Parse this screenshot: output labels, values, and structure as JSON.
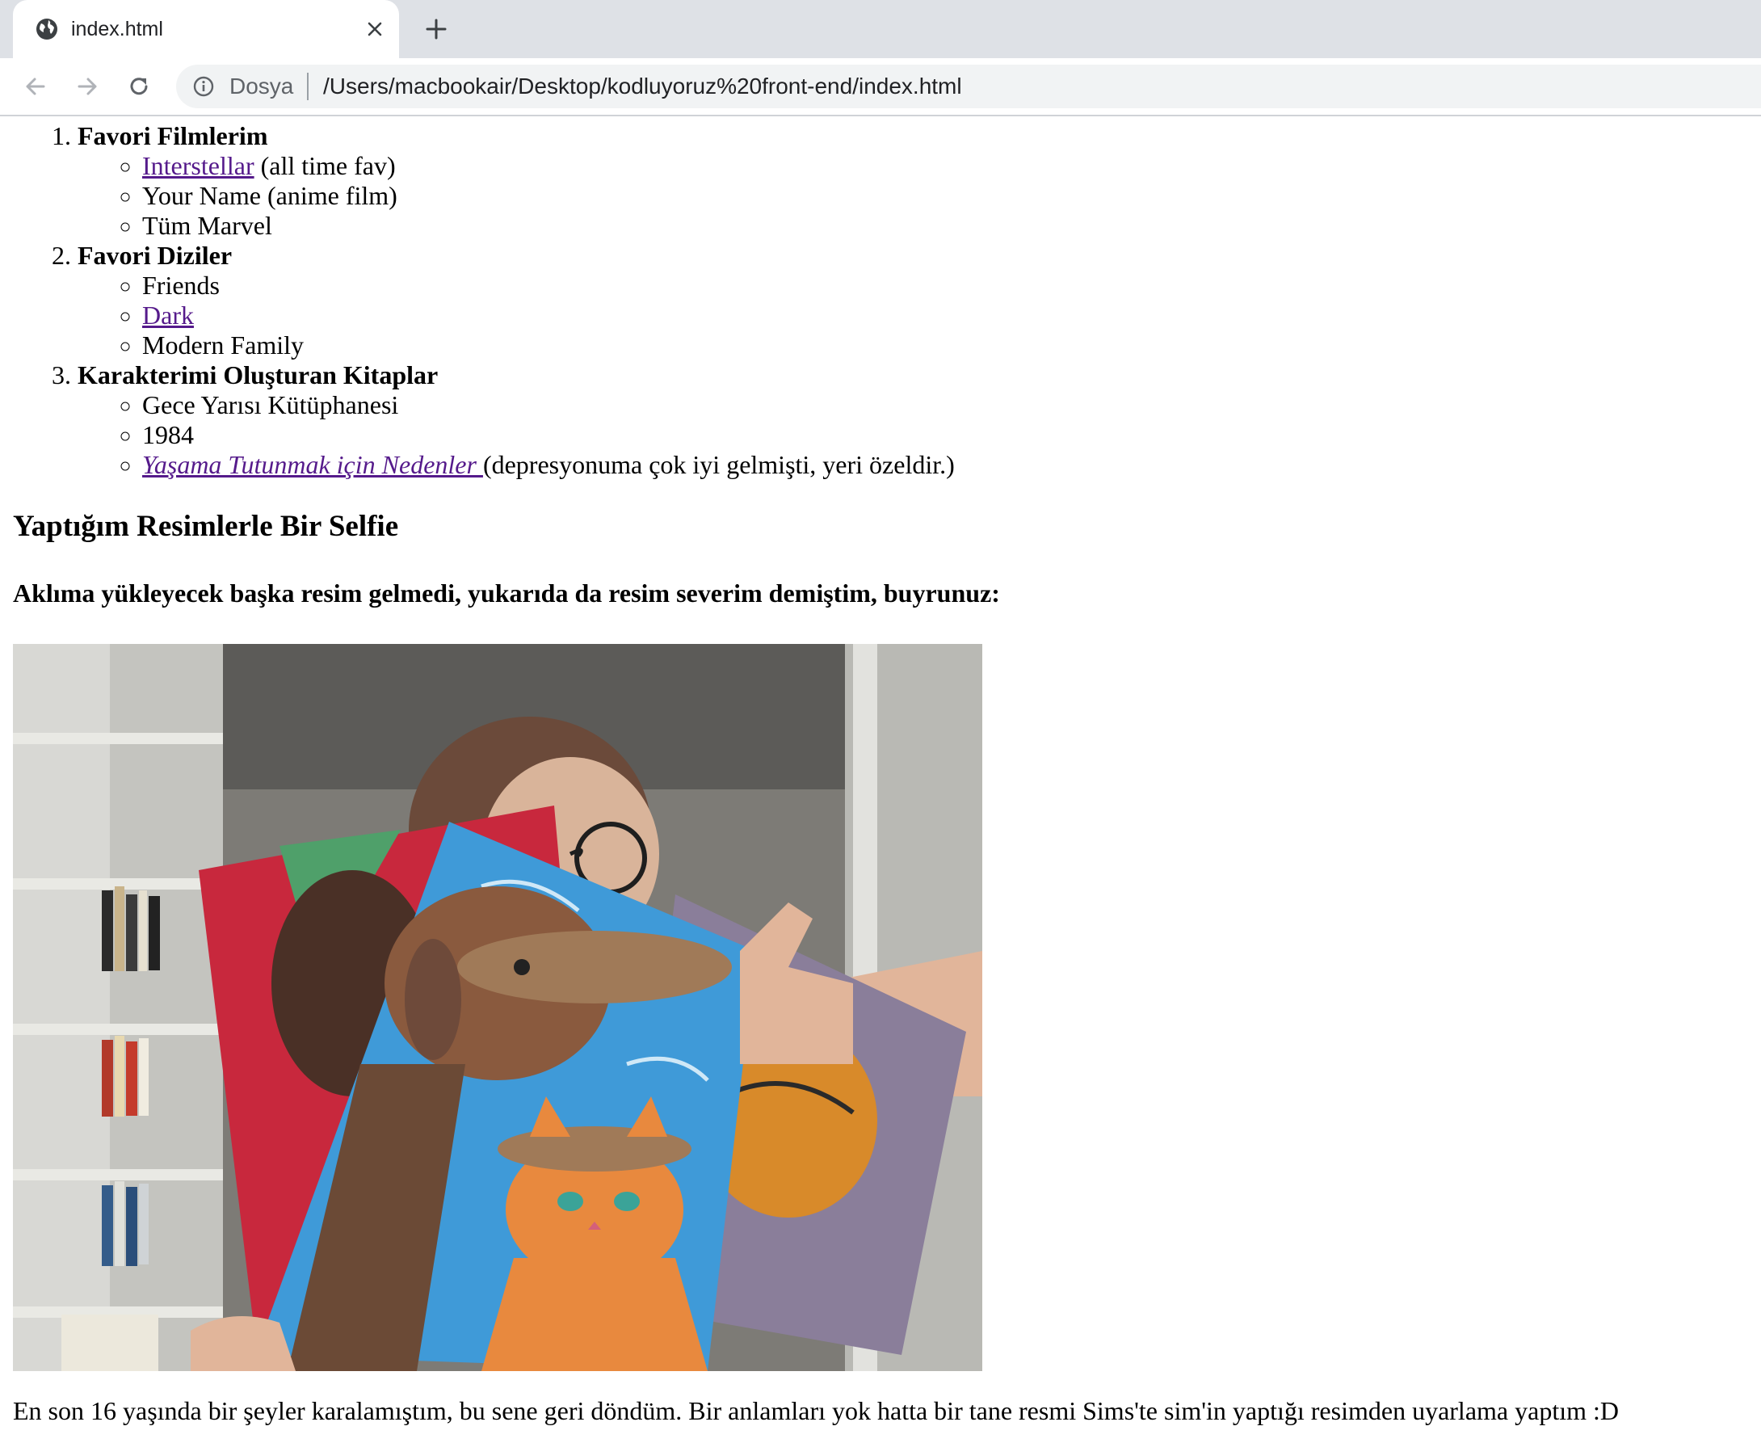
{
  "browser": {
    "tab": {
      "title": "index.html",
      "favicon": "globe-icon",
      "close": "close-icon"
    },
    "new_tab": "plus-icon",
    "nav": {
      "back": "arrow-left-icon",
      "forward": "arrow-right-icon",
      "reload": "reload-icon"
    },
    "omnibox": {
      "scheme_label": "Dosya",
      "url": "/Users/macbookair/Desktop/kodluyoruz%20front-end/index.html",
      "info": "info-icon"
    }
  },
  "page": {
    "lists": [
      {
        "number": "1.",
        "title": "Favori Filmlerim",
        "items": [
          {
            "link": "Interstellar",
            "text": " (all time fav)"
          },
          {
            "text": "Your Name (anime film)"
          },
          {
            "text": "Tüm Marvel"
          }
        ]
      },
      {
        "number": "2.",
        "title": "Favori Diziler",
        "items": [
          {
            "text": "Friends"
          },
          {
            "link": "Dark"
          },
          {
            "text": "Modern Family"
          }
        ]
      },
      {
        "number": "3.",
        "title": "Karakterimi Oluşturan Kitaplar",
        "items": [
          {
            "text": "Gece Yarısı Kütüphanesi"
          },
          {
            "text": "1984"
          },
          {
            "link": "Yaşama Tutunmak için Nedenler ",
            "text": "(depresyonuma çok iyi gelmişti, yeri özeldir.)"
          }
        ]
      }
    ],
    "heading": "Yaptığım Resimlerle Bir Selfie",
    "subheading": "Aklıma yükleyecek başka resim gelmedi, yukarıda da resim severim demiştim, buyrunuz:",
    "caption": "En son 16 yaşında bir şeyler karalamıştım, bu sene geri döndüm. Bir anlamları yok hatta bir tane resmi Sims'te sim'in yaptığı resimden uyarlama yaptım :D"
  },
  "colors": {
    "link": "#551a8b",
    "tabstrip": "#dee1e6",
    "omnibox": "#f1f3f4"
  }
}
